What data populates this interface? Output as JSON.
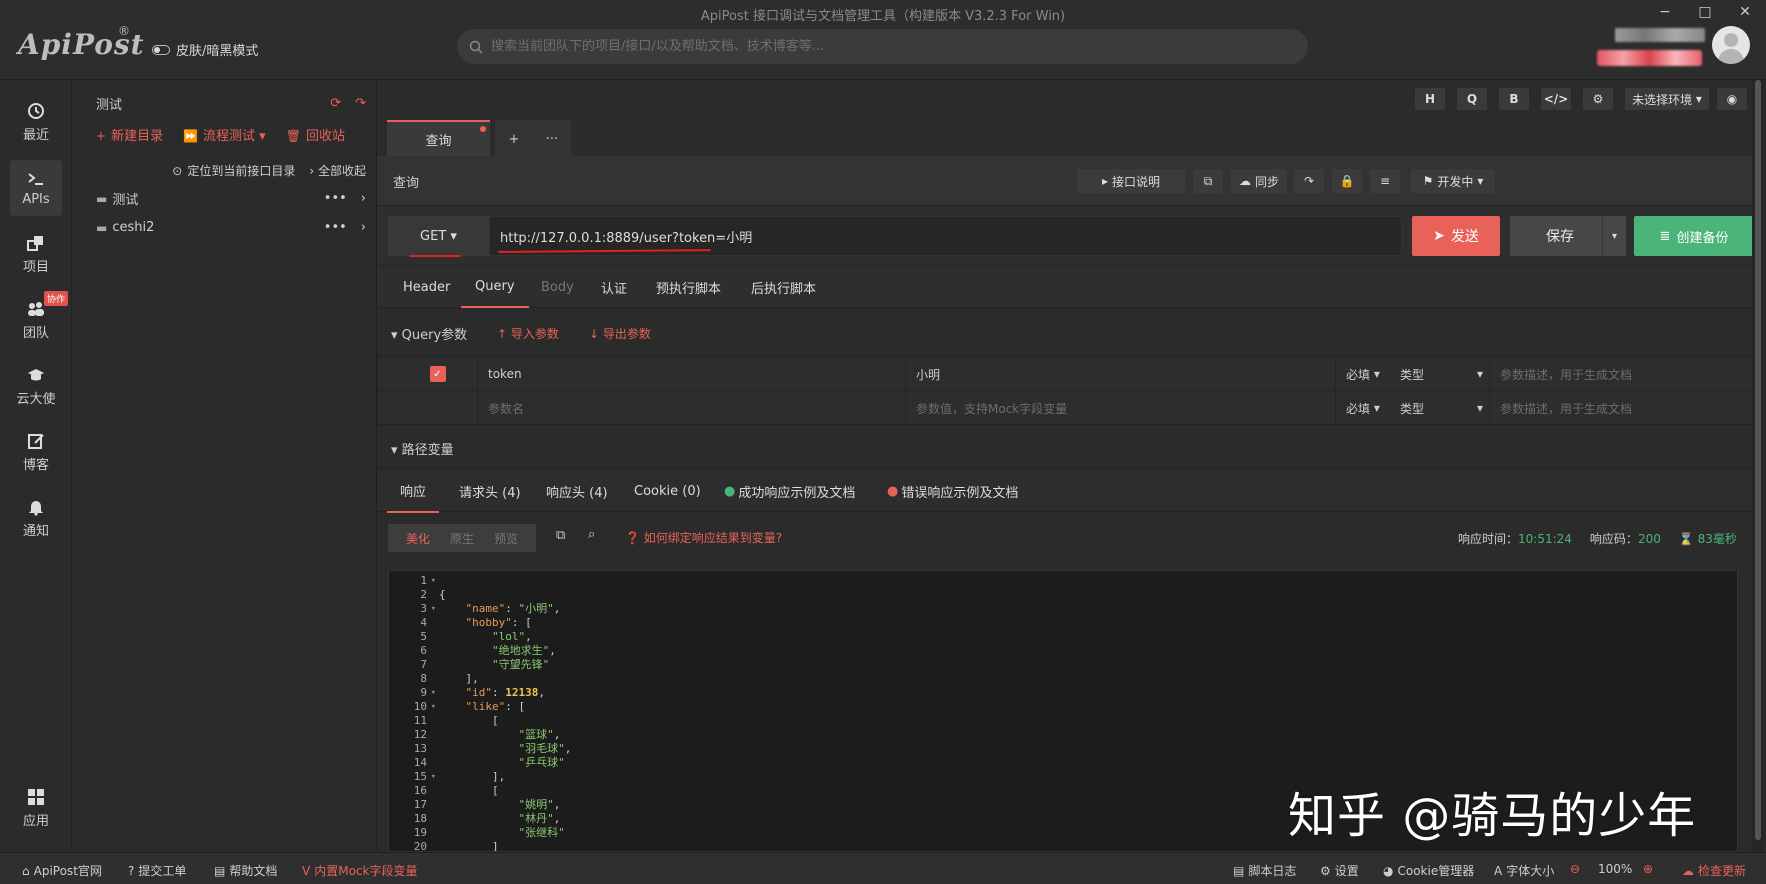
{
  "window": {
    "title": "ApiPost 接口调试与文档管理工具（构建版本 V3.2.3 For Win)",
    "min": "−",
    "max": "□",
    "close": "✕"
  },
  "brand": {
    "logo": "ApiPost",
    "reg": "®",
    "skin_toggle": "皮肤/暗黑模式"
  },
  "search": {
    "placeholder": "搜索当前团队下的项目/接口/以及帮助文档、技术博客等..."
  },
  "nav": [
    {
      "label": "最近",
      "icon": "clock-icon"
    },
    {
      "label": "APIs",
      "icon": "terminal-icon"
    },
    {
      "label": "项目",
      "icon": "folders-icon"
    },
    {
      "label": "团队",
      "icon": "users-icon",
      "badge": "协作"
    },
    {
      "label": "云大使",
      "icon": "graduation-cap-icon"
    },
    {
      "label": "博客",
      "icon": "edit-icon"
    },
    {
      "label": "通知",
      "icon": "bell-icon"
    },
    {
      "label": "应用",
      "icon": "grid-icon"
    }
  ],
  "tree": {
    "title": "测试",
    "new_dir": "新建目录",
    "flow_test": "流程测试",
    "recycle": "回收站",
    "locate": "定位到当前接口目录",
    "collapse": "全部收起",
    "folders": [
      {
        "name": "测试",
        "more": "•••"
      },
      {
        "name": "ceshi2",
        "more": "•••"
      }
    ]
  },
  "toolbar": {
    "h": "H",
    "q": "Q",
    "b": "B",
    "code": "</>",
    "settings": "⚙",
    "env": "未选择环境",
    "eye": "◉"
  },
  "request": {
    "tab": "查询",
    "add": "+",
    "more": "···",
    "name": "查询",
    "doc_btn": "接口说明",
    "sync": "同步",
    "status": "开发中",
    "method": "GET",
    "url": "http://127.0.0.1:8889/user?token=小明",
    "send": "发送",
    "save": "保存",
    "backup": "创建备份"
  },
  "subtabs": [
    "Header",
    "Query",
    "Body",
    "认证",
    "预执行脚本",
    "后执行脚本"
  ],
  "query": {
    "title": "Query参数",
    "import": "导入参数",
    "export": "导出参数",
    "rows": [
      {
        "key": "token",
        "value": "小明",
        "required": "必填",
        "type": "类型",
        "desc": "参数描述，用于生成文档"
      },
      {
        "key": "参数名",
        "value": "参数值，支持Mock字段变量",
        "required": "必填",
        "type": "类型",
        "desc": "参数描述，用于生成文档"
      }
    ]
  },
  "path": {
    "title": "路径变量"
  },
  "response": {
    "tabs": [
      "响应",
      "请求头 (4)",
      "响应头 (4)",
      "Cookie (0)",
      "成功响应示例及文档",
      "错误响应示例及文档"
    ],
    "views": [
      "美化",
      "原生",
      "预览"
    ],
    "bind_tip": "如何绑定响应结果到变量?",
    "time_label": "响应时间：",
    "time": "10:51:24",
    "code_label": "响应码：",
    "code": "200",
    "duration": "83毫秒"
  },
  "code": {
    "lines": [
      "1",
      "2",
      "3",
      "4",
      "5",
      "6",
      "7",
      "8",
      "9",
      "10",
      "11",
      "12",
      "13",
      "14",
      "15",
      "16",
      "17",
      "18",
      "19",
      "20"
    ]
  },
  "watermark": "知乎 @骑马的少年",
  "status": {
    "site": "ApiPost官网",
    "ticket": "提交工单",
    "help": "帮助文档",
    "mock": "内置Mock字段变量",
    "script_log": "脚本日志",
    "settings": "设置",
    "cookie": "Cookie管理器",
    "font": "字体大小",
    "zoom": "100%",
    "update": "检查更新"
  },
  "colors": {
    "accent": "#e9625a",
    "green": "#4bb478",
    "bg": "#2b2b2b"
  }
}
